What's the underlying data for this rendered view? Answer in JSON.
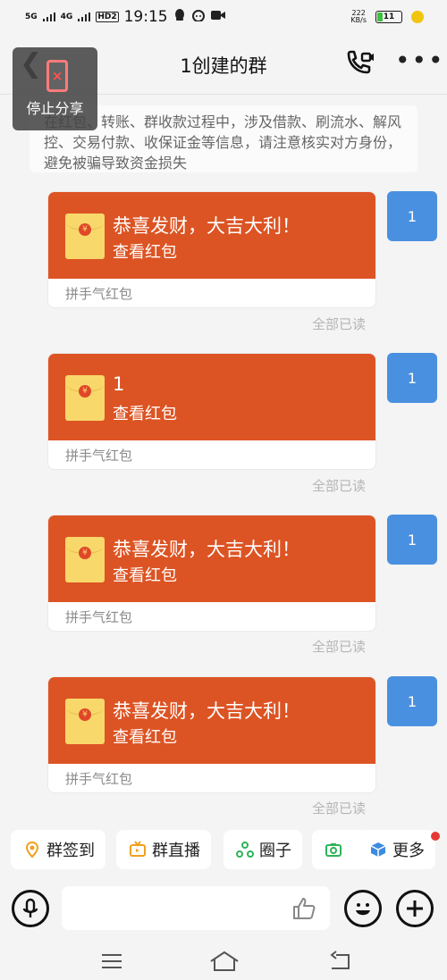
{
  "status_bar": {
    "net1": "5G",
    "net2": "4G",
    "hd": "HD",
    "hd_sub": "2",
    "time": "19:15",
    "speed_value": "222",
    "speed_unit": "KB/s",
    "battery": "11"
  },
  "header": {
    "title": "1创建的群",
    "share_overlay_label": "停止分享"
  },
  "notice": {
    "text": "在红包、转账、群收款过程中，涉及借款、刷流水、解风控、交易付款、收保证金等信息，请注意核实对方身份，避免被骗导致资金损失"
  },
  "messages": [
    {
      "avatar": "1",
      "packet_title": "恭喜发财，大吉大利！",
      "packet_action": "查看红包",
      "packet_type": "拼手气红包",
      "read_status": "全部已读"
    },
    {
      "avatar": "1",
      "packet_title": "1",
      "packet_action": "查看红包",
      "packet_type": "拼手气红包",
      "read_status": "全部已读"
    },
    {
      "avatar": "1",
      "packet_title": "恭喜发财，大吉大利！",
      "packet_action": "查看红包",
      "packet_type": "拼手气红包",
      "read_status": "全部已读"
    },
    {
      "avatar": "1",
      "packet_title": "恭喜发财，大吉大利！",
      "packet_action": "查看红包",
      "packet_type": "拼手气红包",
      "read_status": "全部已读"
    }
  ],
  "toolbar": {
    "checkin": "群签到",
    "live": "群直播",
    "circle": "圈子",
    "more": "更多"
  },
  "input": {
    "placeholder": ""
  },
  "colors": {
    "packet_red": "#dc5424",
    "avatar_blue": "#4a90e0",
    "envelope_gold": "#f8d86b"
  }
}
